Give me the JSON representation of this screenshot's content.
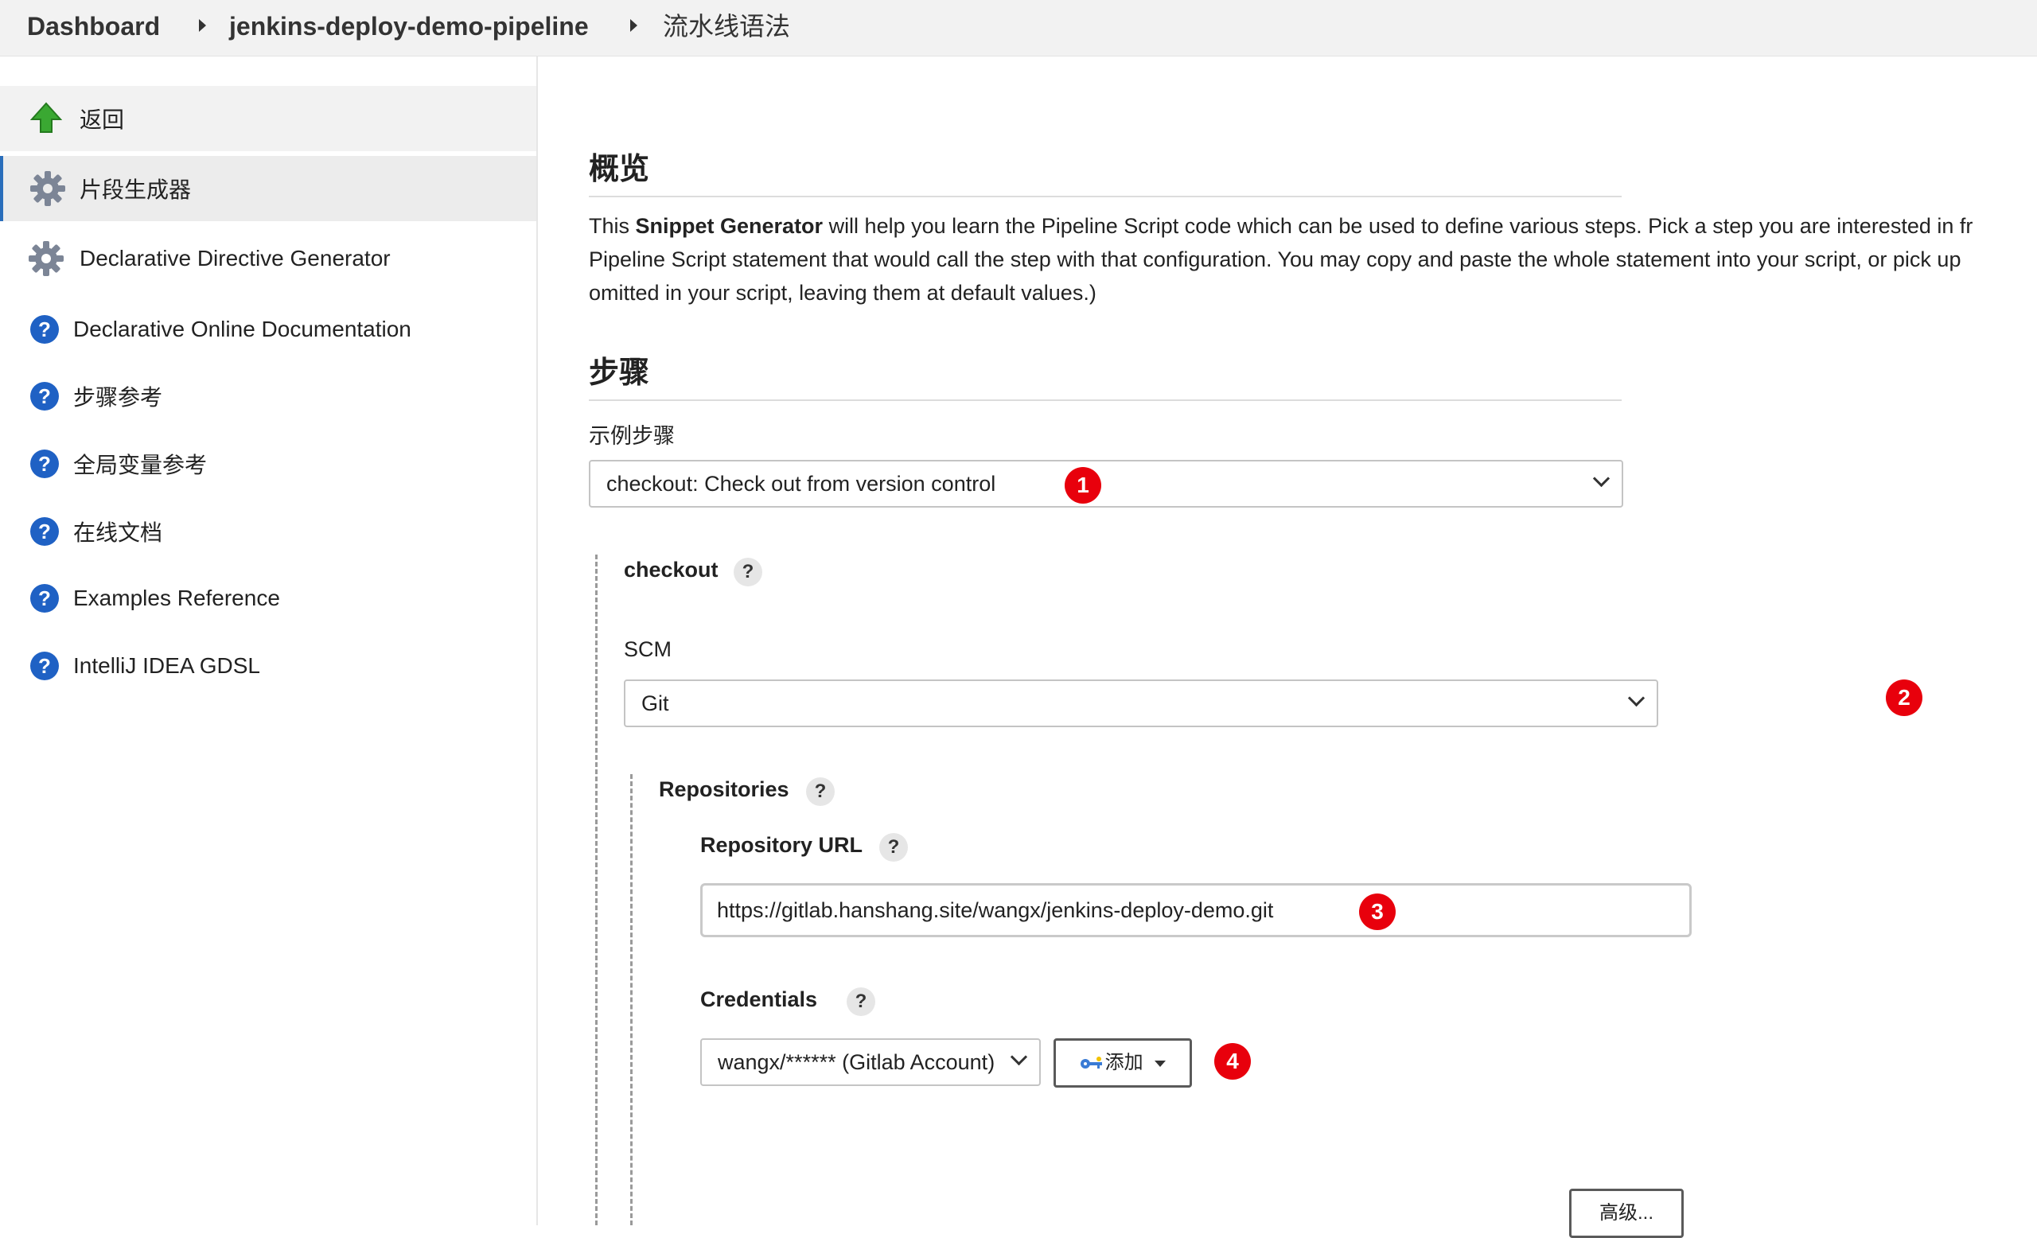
{
  "breadcrumb": {
    "items": [
      "Dashboard",
      "jenkins-deploy-demo-pipeline",
      "流水线语法"
    ]
  },
  "sidebar": {
    "items": [
      {
        "label": "返回",
        "icon": "up-arrow-icon"
      },
      {
        "label": "片段生成器",
        "icon": "gear-icon"
      },
      {
        "label": "Declarative Directive Generator",
        "icon": "gear-icon"
      },
      {
        "label": "Declarative Online Documentation",
        "icon": "help-icon"
      },
      {
        "label": "步骤参考",
        "icon": "help-icon"
      },
      {
        "label": "全局变量参考",
        "icon": "help-icon"
      },
      {
        "label": "在线文档",
        "icon": "help-icon"
      },
      {
        "label": "Examples Reference",
        "icon": "help-icon"
      },
      {
        "label": "IntelliJ IDEA GDSL",
        "icon": "help-icon"
      }
    ]
  },
  "overview": {
    "heading": "概览",
    "line1_pre": "This ",
    "line1_bold": "Snippet Generator",
    "line1_post": " will help you learn the Pipeline Script code which can be used to define various steps. Pick a step you are interested in fr",
    "line2": "Pipeline Script statement that would call the step with that configuration. You may copy and paste the whole statement into your script, or pick up",
    "line3": "omitted in your script, leaving them at default values.)"
  },
  "steps": {
    "heading": "步骤",
    "sample_label": "示例步骤",
    "sample_value": "checkout: Check out from version control",
    "checkout_label": "checkout",
    "scm_label": "SCM",
    "scm_value": "Git",
    "repositories_label": "Repositories",
    "repo_url_label": "Repository URL",
    "repo_url_value": "https://gitlab.hanshang.site/wangx/jenkins-deploy-demo.git",
    "credentials_label": "Credentials",
    "credentials_value": "wangx/****** (Gitlab Account)",
    "add_button": "添加",
    "advanced_button": "高级..."
  },
  "help_glyph": "?",
  "annotations": [
    "1",
    "2",
    "3",
    "4"
  ],
  "colors": {
    "accent": "#2a6ebb",
    "help_blue": "#1f61c4",
    "badge_red": "#e8000c",
    "arrow_green": "#3aa832"
  }
}
